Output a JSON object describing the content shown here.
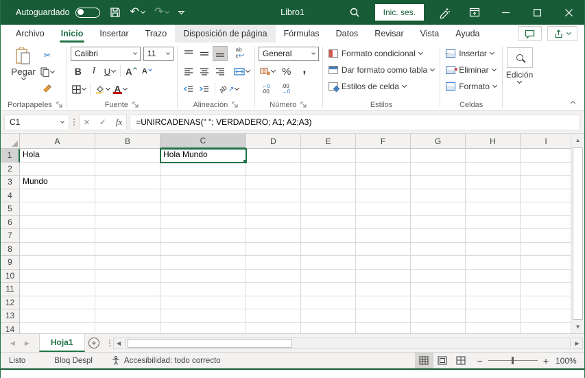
{
  "titlebar": {
    "autosave_label": "Autoguardado",
    "workbook_title": "Libro1",
    "signin_label": "Inic. ses."
  },
  "ribbon_tabs": [
    {
      "label": "Archivo"
    },
    {
      "label": "Inicio"
    },
    {
      "label": "Insertar"
    },
    {
      "label": "Trazo"
    },
    {
      "label": "Disposición de página"
    },
    {
      "label": "Fórmulas"
    },
    {
      "label": "Datos"
    },
    {
      "label": "Revisar"
    },
    {
      "label": "Vista"
    },
    {
      "label": "Ayuda"
    }
  ],
  "ribbon": {
    "clipboard": {
      "group_label": "Portapapeles",
      "paste_label": "Pegar"
    },
    "font": {
      "group_label": "Fuente",
      "font_name": "Calibri",
      "font_size": "11",
      "bold": "B",
      "italic": "I",
      "underline": "U",
      "grow_letter": "A",
      "shrink_letter": "A",
      "color_letter": "A"
    },
    "alignment": {
      "group_label": "Alineación",
      "wrap_top": "ab",
      "wrap_bottom": "c",
      "orient_text": "ab"
    },
    "number": {
      "group_label": "Número",
      "format_name": "General",
      "percent": "%",
      "comma": ",",
      "inc_top": "←0",
      "inc_bottom": ".00",
      "dec_top": ".00",
      "dec_bottom": "→0"
    },
    "styles": {
      "group_label": "Estilos",
      "conditional_label": "Formato condicional",
      "format_table_label": "Dar formato como tabla",
      "cell_styles_label": "Estilos de celda"
    },
    "cells": {
      "group_label": "Celdas",
      "insert_label": "Insertar",
      "delete_label": "Eliminar",
      "format_label": "Formato"
    },
    "editing": {
      "group_label": "Edición"
    }
  },
  "formula_bar": {
    "name_box": "C1",
    "fx_label": "fx",
    "formula": "=UNIRCADENAS(\" \"; VERDADERO; A1; A2;A3)"
  },
  "grid": {
    "columns": [
      "A",
      "B",
      "C",
      "D",
      "E",
      "F",
      "G",
      "H",
      "I"
    ],
    "row_count": 14,
    "selected_column": "C",
    "selected_row": "1",
    "selected_cell": "C1",
    "cells": {
      "A1": "Hola",
      "A3": "Mundo",
      "C1": "Hola Mundo"
    }
  },
  "sheet_bar": {
    "active_sheet": "Hoja1"
  },
  "status_bar": {
    "mode": "Listo",
    "scroll_lock": "Bloq Despl",
    "accessibility": "Accesibilidad: todo correcto",
    "zoom_level": "100%"
  },
  "icons": {
    "scissors": "✂",
    "undo": "↶",
    "redo": "↷",
    "check": "✓",
    "cancel": "×",
    "wrap_return": "↩",
    "merge_arrows": "↔",
    "orient_arrow": "↗",
    "up_triangle": "▲",
    "down_triangle": "▼",
    "left_triangle": "◀",
    "right_triangle": "▶",
    "minus": "−",
    "plus": "+"
  },
  "colors": {
    "title_green": "#185C37",
    "accent_green": "#217346",
    "blue_accent": "#2b7cd3",
    "red_fontcolor": "#c00000"
  }
}
